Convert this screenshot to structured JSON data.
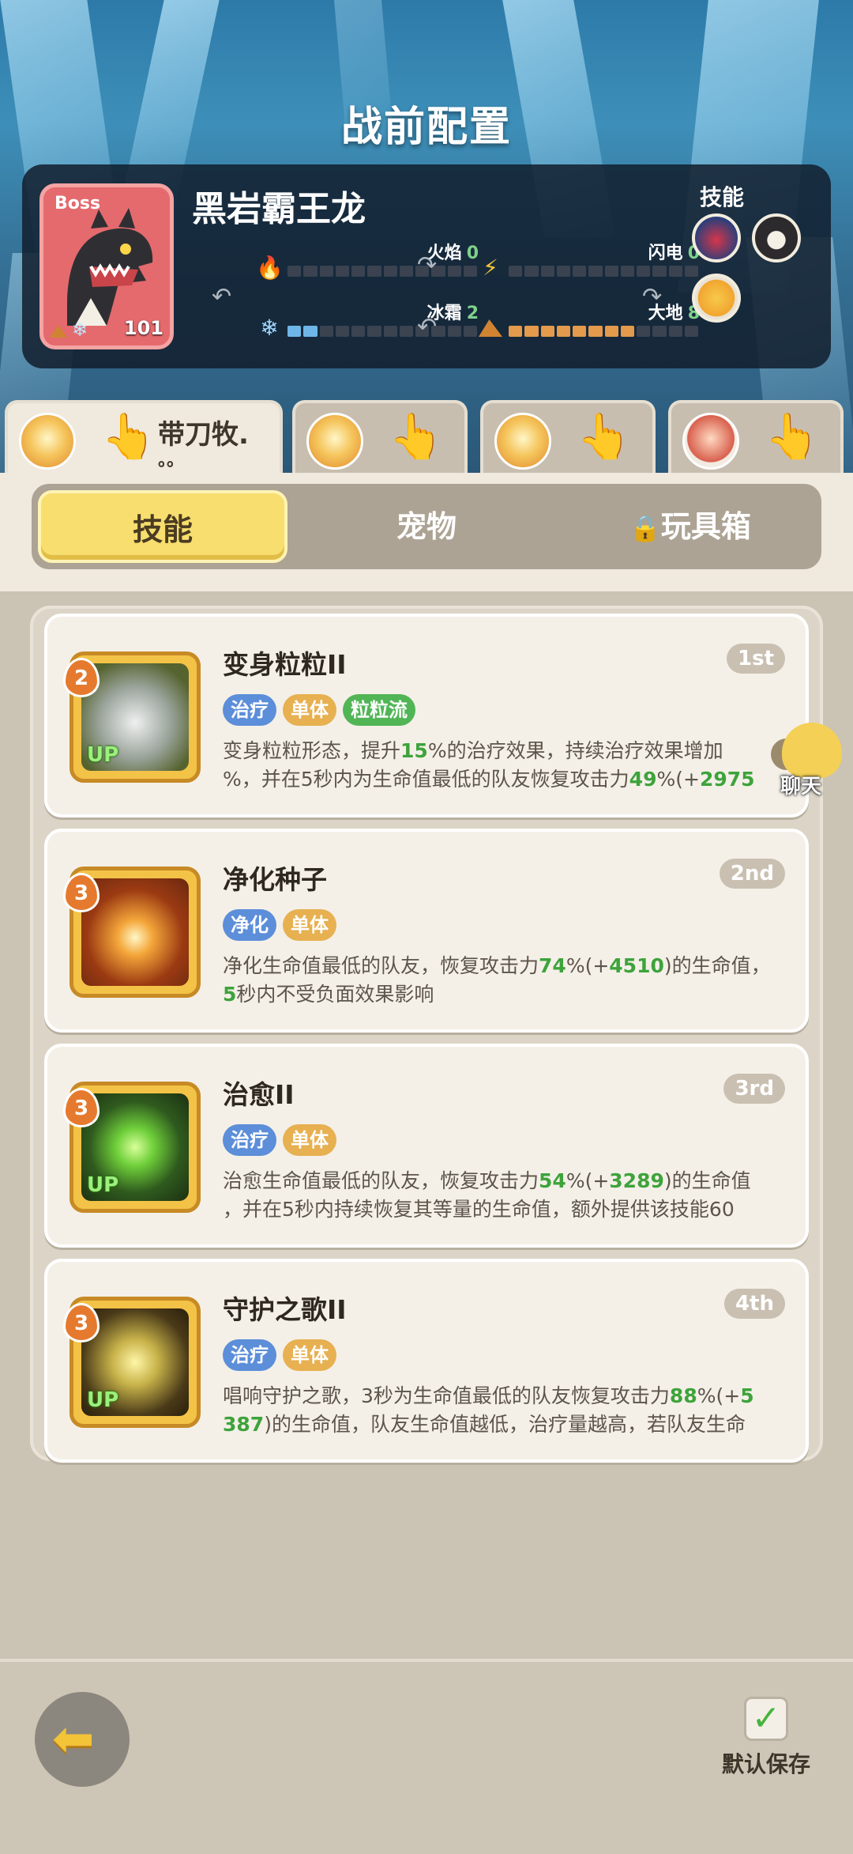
{
  "header": {
    "title": "战前配置"
  },
  "boss": {
    "tag": "Boss",
    "name": "黑岩霸王龙",
    "level": "101",
    "skills_label": "技能",
    "skill_icons": [
      "bird-skill-icon",
      "beast-mouth-skill-icon",
      "lion-skill-icon"
    ],
    "stats": [
      {
        "label": "火焰",
        "value": "0",
        "filled": 0,
        "icon": "fire-icon"
      },
      {
        "label": "闪电",
        "value": "0",
        "filled": 0,
        "icon": "lightning-icon"
      },
      {
        "label": "冰霜",
        "value": "2",
        "filled": 2,
        "icon": "frost-icon"
      },
      {
        "label": "大地",
        "value": "8",
        "filled": 8,
        "icon": "earth-icon"
      }
    ]
  },
  "team_tabs": [
    {
      "name": "带刀牧.",
      "name2": "。。",
      "active": true
    },
    {
      "name": "",
      "active": false
    },
    {
      "name": "",
      "active": false
    },
    {
      "name": "",
      "active": false
    }
  ],
  "segments": {
    "skills": "技能",
    "pets": "宠物",
    "toybox": "玩具箱"
  },
  "cards": [
    {
      "name": "变身粒粒II",
      "rank": "1st",
      "level": "2",
      "up": "UP",
      "tags": [
        "治疗",
        "单体",
        "粒粒流"
      ],
      "desc_line1_a": "变身粒粒形态，提升",
      "desc_line1_g": "15",
      "desc_line1_b": "%的治疗效果，持续治疗效果增加",
      "desc_line2_a": "%，并在5秒内为生命值最低的队友恢复攻击力",
      "desc_line2_g": "49",
      "desc_line2_b": "%(+",
      "desc_line2_g2": "2975",
      "ellipsis": "…"
    },
    {
      "name": "净化种子",
      "rank": "2nd",
      "level": "3",
      "tags": [
        "净化",
        "单体"
      ],
      "desc_line1_a": "净化生命值最低的队友，恢复攻击力",
      "desc_line1_g": "74",
      "desc_line1_b": "%(+",
      "desc_line1_g2": "4510",
      "desc_line1_c": ")的生命值，",
      "desc_line2_g": "5",
      "desc_line2_a": "秒内不受负面效果影响"
    },
    {
      "name": "治愈II",
      "rank": "3rd",
      "level": "3",
      "up": "UP",
      "tags": [
        "治疗",
        "单体"
      ],
      "desc_line1_a": "治愈生命值最低的队友，恢复攻击力",
      "desc_line1_g": "54",
      "desc_line1_b": "%(+",
      "desc_line1_g2": "3289",
      "desc_line1_c": ")的生命值",
      "desc_line2_a": "，并在5秒内持续恢复其等量的生命值，额外提供该技能60",
      "ellipsis": "…"
    },
    {
      "name": "守护之歌II",
      "rank": "4th",
      "level": "3",
      "up": "UP",
      "tags": [
        "治疗",
        "单体"
      ],
      "desc_line1_a": "唱响守护之歌，3秒为生命值最低的队友恢复攻击力",
      "desc_line1_g": "88",
      "desc_line1_b": "%(+",
      "desc_line1_g2": "5",
      "desc_line2_g": "387",
      "desc_line2_a": ")的生命值，队友生命值越低，治疗量越高，若队友生命",
      "ellipsis": "…"
    }
  ],
  "chat": {
    "label": "聊天"
  },
  "footer": {
    "save_label": "默认保存"
  }
}
